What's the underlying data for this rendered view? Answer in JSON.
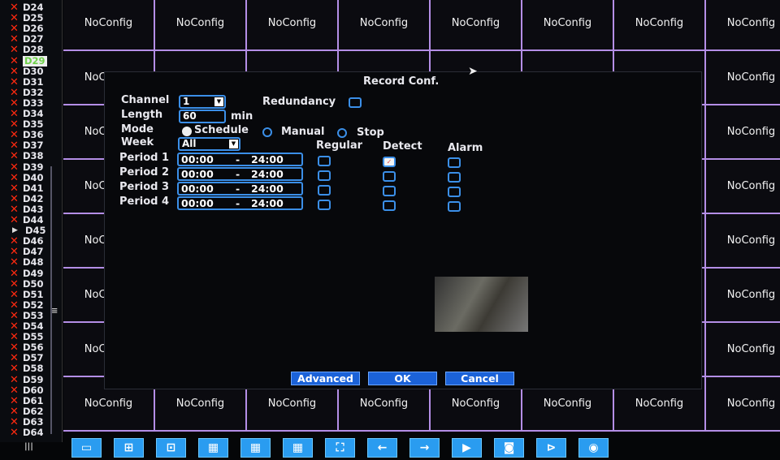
{
  "sidebar": {
    "channels": [
      {
        "label": "D24",
        "status": "x"
      },
      {
        "label": "D25",
        "status": "x"
      },
      {
        "label": "D26",
        "status": "x"
      },
      {
        "label": "D27",
        "status": "x"
      },
      {
        "label": "D28",
        "status": "x"
      },
      {
        "label": "D29",
        "status": "x",
        "selected": true
      },
      {
        "label": "D30",
        "status": "x"
      },
      {
        "label": "D31",
        "status": "x"
      },
      {
        "label": "D32",
        "status": "x"
      },
      {
        "label": "D33",
        "status": "x"
      },
      {
        "label": "D34",
        "status": "x"
      },
      {
        "label": "D35",
        "status": "x"
      },
      {
        "label": "D36",
        "status": "x"
      },
      {
        "label": "D37",
        "status": "x"
      },
      {
        "label": "D38",
        "status": "x"
      },
      {
        "label": "D39",
        "status": "x"
      },
      {
        "label": "D40",
        "status": "x"
      },
      {
        "label": "D41",
        "status": "x"
      },
      {
        "label": "D42",
        "status": "x"
      },
      {
        "label": "D43",
        "status": "x"
      },
      {
        "label": "D44",
        "status": "x"
      },
      {
        "label": "D45",
        "status": "play"
      },
      {
        "label": "D46",
        "status": "x"
      },
      {
        "label": "D47",
        "status": "x"
      },
      {
        "label": "D48",
        "status": "x"
      },
      {
        "label": "D49",
        "status": "x"
      },
      {
        "label": "D50",
        "status": "x"
      },
      {
        "label": "D51",
        "status": "x"
      },
      {
        "label": "D52",
        "status": "x"
      },
      {
        "label": "D53",
        "status": "x"
      },
      {
        "label": "D54",
        "status": "x"
      },
      {
        "label": "D55",
        "status": "x"
      },
      {
        "label": "D56",
        "status": "x"
      },
      {
        "label": "D57",
        "status": "x"
      },
      {
        "label": "D58",
        "status": "x"
      },
      {
        "label": "D59",
        "status": "x"
      },
      {
        "label": "D60",
        "status": "x"
      },
      {
        "label": "D61",
        "status": "x"
      },
      {
        "label": "D62",
        "status": "x"
      },
      {
        "label": "D63",
        "status": "x"
      },
      {
        "label": "D64",
        "status": "x"
      }
    ]
  },
  "grid": {
    "tile_label": "NoConfig"
  },
  "dialog": {
    "title": "Record Conf.",
    "channel_label": "Channel",
    "channel_value": "1",
    "redundancy_label": "Redundancy",
    "redundancy_checked": false,
    "length_label": "Length",
    "length_value": "60",
    "length_unit": "min",
    "mode_label": "Mode",
    "modes": [
      "Schedule",
      "Manual",
      "Stop"
    ],
    "mode_selected": "Schedule",
    "week_label": "Week",
    "week_value": "All",
    "col_headers": [
      "Regular",
      "Detect",
      "Alarm"
    ],
    "periods": [
      {
        "label": "Period 1",
        "start": "00:00",
        "end": "24:00",
        "regular": false,
        "detect": true,
        "alarm": false
      },
      {
        "label": "Period 2",
        "start": "00:00",
        "end": "24:00",
        "regular": false,
        "detect": false,
        "alarm": false
      },
      {
        "label": "Period 3",
        "start": "00:00",
        "end": "24:00",
        "regular": false,
        "detect": false,
        "alarm": false
      },
      {
        "label": "Period 4",
        "start": "00:00",
        "end": "24:00",
        "regular": false,
        "detect": false,
        "alarm": false
      }
    ],
    "separator": "-",
    "buttons": {
      "advanced": "Advanced",
      "ok": "OK",
      "cancel": "Cancel"
    }
  },
  "toolbar": {
    "icons": [
      "single-view-icon",
      "quad-view-icon",
      "view-1plus5-icon",
      "view-16-icon",
      "view-25-icon",
      "view-36-icon",
      "fullscreen-icon",
      "previous-icon",
      "next-icon",
      "play-icon",
      "record-icon",
      "playback-icon",
      "stop-record-icon"
    ]
  }
}
